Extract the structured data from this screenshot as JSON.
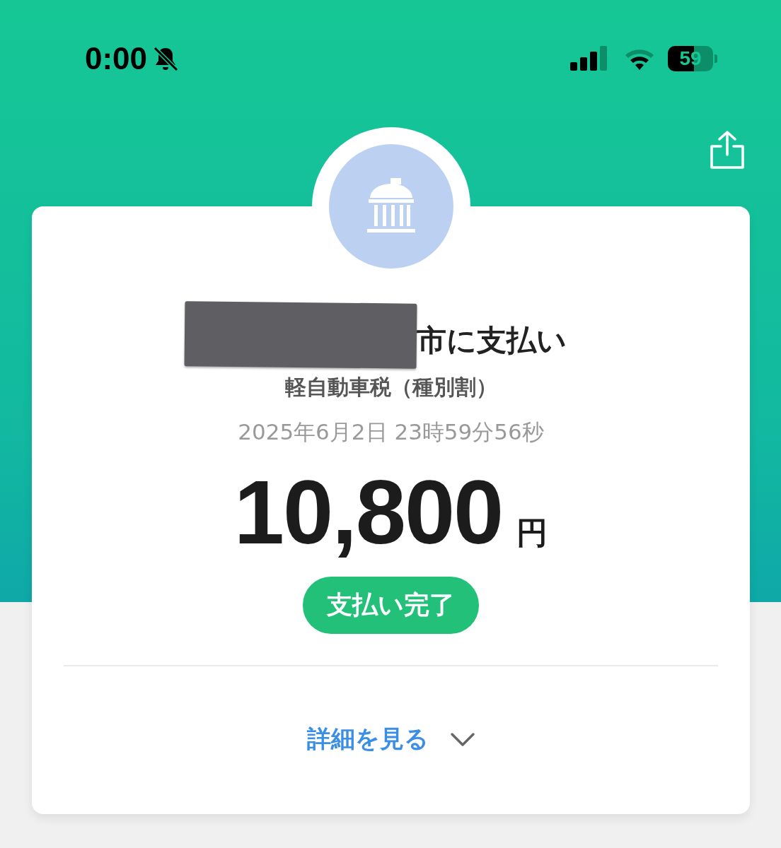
{
  "status_bar": {
    "time": "0:00",
    "battery": "59"
  },
  "payment": {
    "title": "市に支払い",
    "subtitle": "軽自動車税（種別割）",
    "datetime": "2025年6月2日 23時59分56秒",
    "amount": "10,800",
    "currency": "円",
    "status": "支払い完了",
    "details_link": "詳細を見る"
  }
}
